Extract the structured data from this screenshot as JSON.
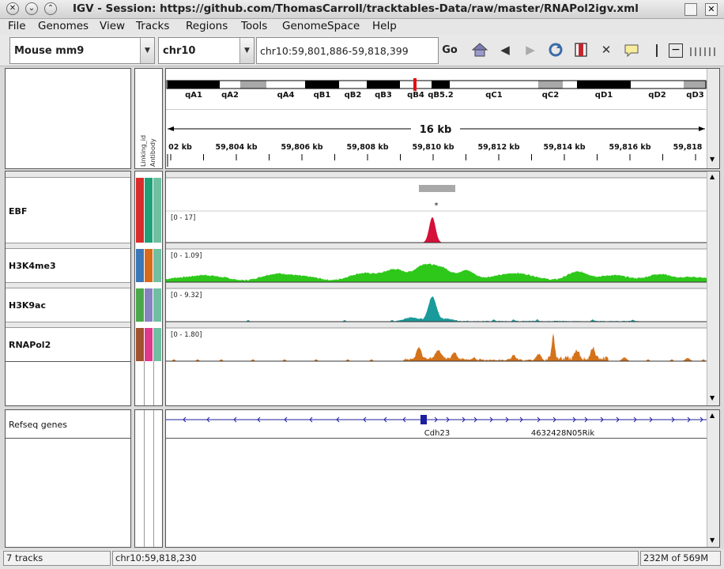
{
  "window": {
    "title": "IGV - Session: https://github.com/ThomasCarroll/tracktables-Data/raw/master/RNAPol2igv.xml"
  },
  "menu": [
    "File",
    "Genomes",
    "View",
    "Tracks",
    "Regions",
    "Tools",
    "GenomeSpace",
    "Help"
  ],
  "toolbar": {
    "genome": "Mouse mm9",
    "chromosome": "chr10",
    "locus": "chr10:59,801,886-59,818,399",
    "go": "Go"
  },
  "attributes": {
    "headers": [
      "Linking_id",
      "Antibody"
    ]
  },
  "ideogram": {
    "bands": [
      {
        "type": "acen",
        "name": ""
      },
      {
        "type": "gpos",
        "name": "qA1"
      },
      {
        "type": "gneg",
        "name": "qA2"
      },
      {
        "type": "gvar",
        "name": ""
      },
      {
        "type": "gneg",
        "name": "qA4"
      },
      {
        "type": "gpos",
        "name": "qB1"
      },
      {
        "type": "gneg",
        "name": "qB2"
      },
      {
        "type": "gpos",
        "name": "qB3"
      },
      {
        "type": "gneg",
        "name": "qB4"
      },
      {
        "type": "gpos",
        "name": "qB5.2"
      },
      {
        "type": "gneg",
        "name": "qC1"
      },
      {
        "type": "gvar",
        "name": "qC2"
      },
      {
        "type": "gneg",
        "name": ""
      },
      {
        "type": "gpos",
        "name": "qD1"
      },
      {
        "type": "gneg",
        "name": "qD2"
      },
      {
        "type": "gvar",
        "name": "qD3"
      }
    ]
  },
  "ruler": {
    "span": "16 kb",
    "ticks": [
      "02 kb",
      "59,804 kb",
      "59,806 kb",
      "59,808 kb",
      "59,810 kb",
      "59,812 kb",
      "59,814 kb",
      "59,816 kb",
      "59,818"
    ]
  },
  "tracks": [
    {
      "name": "EBF",
      "range": "[0 - 17]",
      "color": "#d4103a",
      "attr": [
        "#d92b2b",
        "#1fa078",
        "#6fbfa0"
      ],
      "feature_label": "*"
    },
    {
      "name": "H3K4me3",
      "range": "[0 - 1.09]",
      "color": "#2ec81a",
      "attr": [
        "#3a77b8",
        "#d96a1a",
        "#6fbfa0"
      ]
    },
    {
      "name": "H3K9ac",
      "range": "[0 - 9.32]",
      "color": "#1a9a9a",
      "attr": [
        "#4aa84a",
        "#8583c0",
        "#6fbfa0"
      ]
    },
    {
      "name": "RNAPol2",
      "range": "[0 - 1.80]",
      "color": "#d4721a",
      "attr": [
        "#a0522d",
        "#e0388a",
        "#6fbfa0"
      ]
    }
  ],
  "genes": {
    "track_name": "Refseq genes",
    "labels": [
      "Cdh23",
      "4632428N05Rik"
    ]
  },
  "status": {
    "tracks": "7 tracks",
    "position": "chr10:59,818,230",
    "memory": "232M of 569M"
  }
}
